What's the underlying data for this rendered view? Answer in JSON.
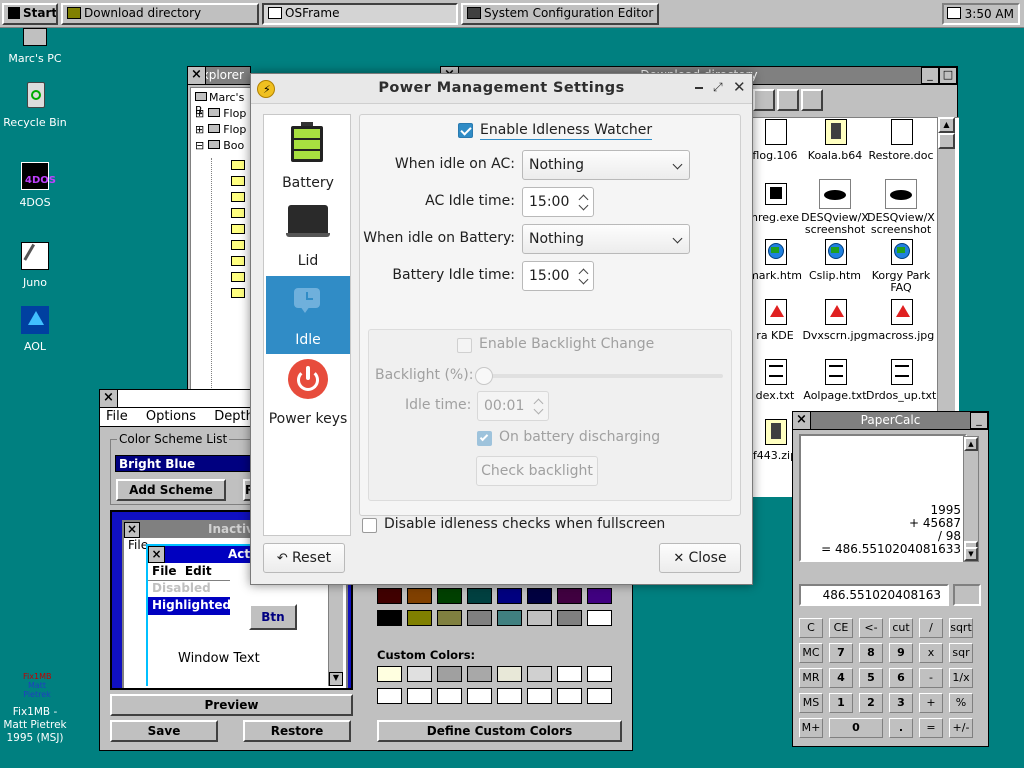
{
  "taskbar": {
    "start": "Start",
    "buttons": [
      "Download directory",
      "OSFrame",
      "System Configuration Editor"
    ],
    "clock": "3:50 AM"
  },
  "desktop_icons": [
    {
      "label": "Marc's PC",
      "icon": "computer-icon"
    },
    {
      "label": "Recycle Bin",
      "icon": "recycle-bin-icon"
    },
    {
      "label": "4DOS",
      "icon": "4dos-icon"
    },
    {
      "label": "Juno",
      "icon": "juno-icon"
    },
    {
      "label": "AOL",
      "icon": "aol-icon"
    },
    {
      "label": "Fix1MB - Matt Pietrek 1995 (MSJ)",
      "icon": "fix1mb-icon"
    }
  ],
  "explorer": {
    "title": "Explorer",
    "tree": [
      "Marc's R",
      "Flop",
      "Flop",
      "Boo"
    ]
  },
  "download": {
    "title": "Download directory",
    "files": [
      {
        "name": "flog.106",
        "icon": "document-icon"
      },
      {
        "name": "Koala.b64",
        "icon": "archive-icon"
      },
      {
        "name": "Restore.doc",
        "icon": "document-icon"
      },
      {
        "name": "nreg.exe",
        "icon": "executable-icon"
      },
      {
        "name": "DESQview/X screenshot",
        "icon": "eye-image-icon"
      },
      {
        "name": "DESQview/X screenshot",
        "icon": "eye-image-icon"
      },
      {
        "name": "mark.htm",
        "icon": "web-page-icon"
      },
      {
        "name": "Cslip.htm",
        "icon": "web-page-icon"
      },
      {
        "name": "Korgy Park FAQ",
        "icon": "web-page-icon"
      },
      {
        "name": "ra KDE",
        "icon": "image-icon"
      },
      {
        "name": "Dvxscrn.jpg",
        "icon": "image-icon"
      },
      {
        "name": "macross.jpg",
        "icon": "image-icon"
      },
      {
        "name": "dex.txt",
        "icon": "text-file-icon"
      },
      {
        "name": "Aolpage.txt",
        "icon": "text-file-icon"
      },
      {
        "name": "Drdos_up.txt",
        "icon": "text-file-icon"
      },
      {
        "name": "f443.zip",
        "icon": "archive-icon"
      }
    ]
  },
  "color": {
    "menu": [
      "File",
      "Options",
      "Depth"
    ],
    "scheme_label": "Color Scheme List",
    "scheme_value": "Bright Blue",
    "add_scheme": "Add Scheme",
    "inactive": "Inactive",
    "active": "Activ",
    "file": "File",
    "inner_menu": "File  Edit",
    "disabled": "Disabled",
    "highlighted": "Highlighted",
    "btn": "Btn",
    "window_text": "Window Text",
    "preview": "Preview",
    "save": "Save",
    "restore": "Restore",
    "custom_colors": "Custom Colors:",
    "define": "Define Custom Colors",
    "palette_row1": [
      "#400000",
      "#804000",
      "#004000",
      "#004040",
      "#000080",
      "#000040",
      "#400040",
      "#400080"
    ],
    "palette_row2": [
      "#000000",
      "#808000",
      "#808040",
      "#808080",
      "#408080",
      "#c0c0c0",
      "#808080",
      "#ffffff"
    ],
    "custom_row1": [
      "#ffffe0",
      "#e0e0e0",
      "#a0a0a0",
      "#a8a8a8",
      "#e8e8d8",
      "#d0d0d0",
      "#ffffff",
      "#ffffff"
    ],
    "custom_row2": [
      "#ffffff",
      "#ffffff",
      "#ffffff",
      "#ffffff",
      "#ffffff",
      "#ffffff",
      "#ffffff",
      "#ffffff"
    ]
  },
  "pm": {
    "title": "Power Management Settings",
    "categories": [
      {
        "label": "Battery",
        "icon": "battery-icon"
      },
      {
        "label": "Lid",
        "icon": "laptop-lid-icon"
      },
      {
        "label": "Idle",
        "icon": "idle-icon"
      },
      {
        "label": "Power keys",
        "icon": "power-icon"
      }
    ],
    "enable_idleness": "Enable Idleness Watcher",
    "idle_ac_label": "When idle on AC:",
    "idle_ac_value": "Nothing",
    "ac_time_label": "AC Idle time:",
    "ac_time_value": "15:00",
    "idle_batt_label": "When idle on Battery:",
    "idle_batt_value": "Nothing",
    "batt_time_label": "Battery Idle time:",
    "batt_time_value": "15:00",
    "backlight_change": "Enable Backlight Change",
    "backlight_label": "Backlight (%):",
    "backlight_level": 0,
    "idle_time_label": "Idle time:",
    "idle_time_value": "00:01",
    "on_battery": "On battery discharging",
    "check_backlight": "Check backlight",
    "disable_fullscreen": "Disable idleness checks when fullscreen",
    "reset": "Reset",
    "close": "Close",
    "accent": "#308cc6"
  },
  "calc": {
    "title": "PaperCalc",
    "tape": [
      "1995",
      "+ 45687",
      "/ 98",
      "= 486.5510204081633"
    ],
    "display": "486.551020408163",
    "buttons": [
      [
        "C",
        "CE",
        "<-",
        "cut",
        "/",
        "sqrt"
      ],
      [
        "MC",
        "7",
        "8",
        "9",
        "x",
        "sqr"
      ],
      [
        "MR",
        "4",
        "5",
        "6",
        "-",
        "1/x"
      ],
      [
        "MS",
        "1",
        "2",
        "3",
        "+",
        "%"
      ],
      [
        "M+",
        "0",
        ".",
        "=",
        "+/-"
      ]
    ]
  }
}
